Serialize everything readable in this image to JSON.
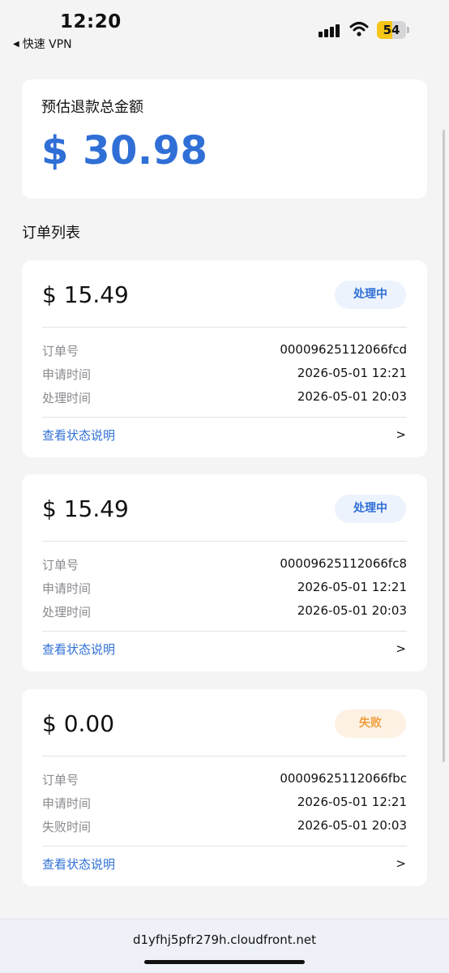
{
  "status_bar": {
    "time": "12:20",
    "back_app": "快速 VPN",
    "back_icon": "back-triangle-icon",
    "battery_percent": "54",
    "battery_level": 0.54,
    "colors": {
      "battery_fill": "#f5c518"
    }
  },
  "summary": {
    "label": "预估退款总金额",
    "amount": "$ 30.98",
    "accent_color": "#2f6fd6"
  },
  "section_title": "订单列表",
  "orders": [
    {
      "amount": "$ 15.49",
      "status": "处理中",
      "status_type": "processing",
      "rows": [
        {
          "label": "订单号",
          "value": "00009625112066fcd"
        },
        {
          "label": "申请时间",
          "value": "2026-05-01 12:21"
        },
        {
          "label": "处理时间",
          "value": "2026-05-01 20:03"
        }
      ],
      "link": "查看状态说明",
      "chevron": ">"
    },
    {
      "amount": "$ 15.49",
      "status": "处理中",
      "status_type": "processing",
      "rows": [
        {
          "label": "订单号",
          "value": "00009625112066fc8"
        },
        {
          "label": "申请时间",
          "value": "2026-05-01 12:21"
        },
        {
          "label": "处理时间",
          "value": "2026-05-01 20:03"
        }
      ],
      "link": "查看状态说明",
      "chevron": ">"
    },
    {
      "amount": "$ 0.00",
      "status": "失败",
      "status_type": "failed",
      "rows": [
        {
          "label": "订单号",
          "value": "00009625112066fbc"
        },
        {
          "label": "申请时间",
          "value": "2026-05-01 12:21"
        },
        {
          "label": "失败时间",
          "value": "2026-05-01 20:03"
        }
      ],
      "link": "查看状态说明",
      "chevron": ">"
    }
  ],
  "browser": {
    "url": "d1yfhj5pfr279h.cloudfront.net"
  }
}
